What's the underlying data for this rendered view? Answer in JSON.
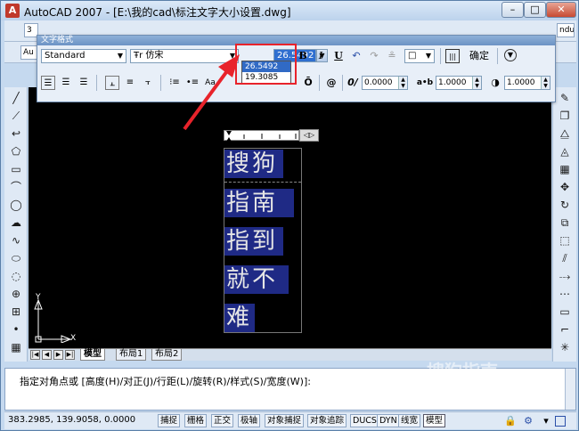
{
  "window": {
    "title": "AutoCAD 2007 - [E:\\我的cad\\标注文字大小设置.dwg]"
  },
  "toolbar_bg": {
    "stub1": "3",
    "stub2": "Au",
    "stub3": "ndu"
  },
  "text_format": {
    "title": "文字格式",
    "style": "Standard",
    "font": "仿宋",
    "font_prefix": "Ŧr",
    "height": "26.5492",
    "height_options": [
      "26.5492",
      "19.3085"
    ],
    "bold": "B",
    "italic": "I",
    "underline": "U",
    "ok": "确定",
    "tracking": "0.0000",
    "width_factor": "1.0000",
    "oblique": "1.0000",
    "oblique_angle": "0/",
    "ab": "a•b",
    "at": "@"
  },
  "mtext_lines": [
    "搜狗",
    "指南",
    "指到",
    "就不",
    "难"
  ],
  "ucs": {
    "y": "Y",
    "x": "X"
  },
  "tabs": [
    "模型",
    "布局1",
    "布局2"
  ],
  "command": "指定对角点或 [高度(H)/对正(J)/行距(L)/旋转(R)/样式(S)/宽度(W)]:",
  "status": {
    "coords": "383.2985, 139.9058, 0.0000",
    "buttons": [
      "捕捉",
      "栅格",
      "正交",
      "极轴",
      "对象捕捉",
      "对象追踪",
      "DUCS",
      "DYN",
      "线宽",
      "模型"
    ]
  },
  "watermark": {
    "text": "搜狗指南",
    "url": "zhinan.sogou.com"
  },
  "colors": {
    "highlight": "#e8232b",
    "selection": "#316ac5",
    "mtext_bg": "#1f2a85"
  }
}
